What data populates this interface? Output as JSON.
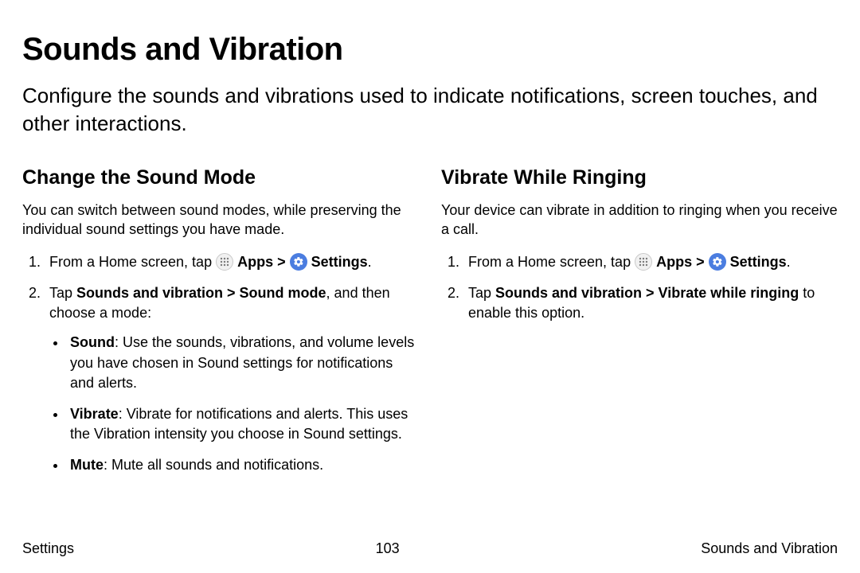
{
  "page": {
    "title": "Sounds and Vibration",
    "intro": "Configure the sounds and vibrations used to indicate notifications, screen touches, and other interactions."
  },
  "left": {
    "heading": "Change the Sound Mode",
    "intro": "You can switch between sound modes, while preserving the individual sound settings you have made.",
    "step1_prefix": "From a Home screen, tap ",
    "apps_label": "Apps",
    "settings_label": "Settings",
    "step2_a": "Tap ",
    "step2_path": "Sounds and vibration > Sound mode",
    "step2_b": ", and then choose a mode:",
    "bullets": {
      "sound_label": "Sound",
      "sound_text": ": Use the sounds, vibrations, and volume levels you have chosen in Sound settings for notifications and alerts.",
      "vibrate_label": "Vibrate",
      "vibrate_text": ": Vibrate for notifications and alerts. This uses the Vibration intensity you choose in Sound settings.",
      "mute_label": "Mute",
      "mute_text": ": Mute all sounds and notifications."
    }
  },
  "right": {
    "heading": "Vibrate While Ringing",
    "intro": "Your device can vibrate in addition to ringing when you receive a call.",
    "step1_prefix": "From a Home screen, tap ",
    "apps_label": "Apps",
    "settings_label": "Settings",
    "step2_a": "Tap ",
    "step2_path": "Sounds and vibration > Vibrate while ringing",
    "step2_b": " to enable this option."
  },
  "footer": {
    "left": "Settings",
    "center": "103",
    "right": "Sounds and Vibration"
  },
  "glyphs": {
    "chevron": ">",
    "period": "."
  }
}
